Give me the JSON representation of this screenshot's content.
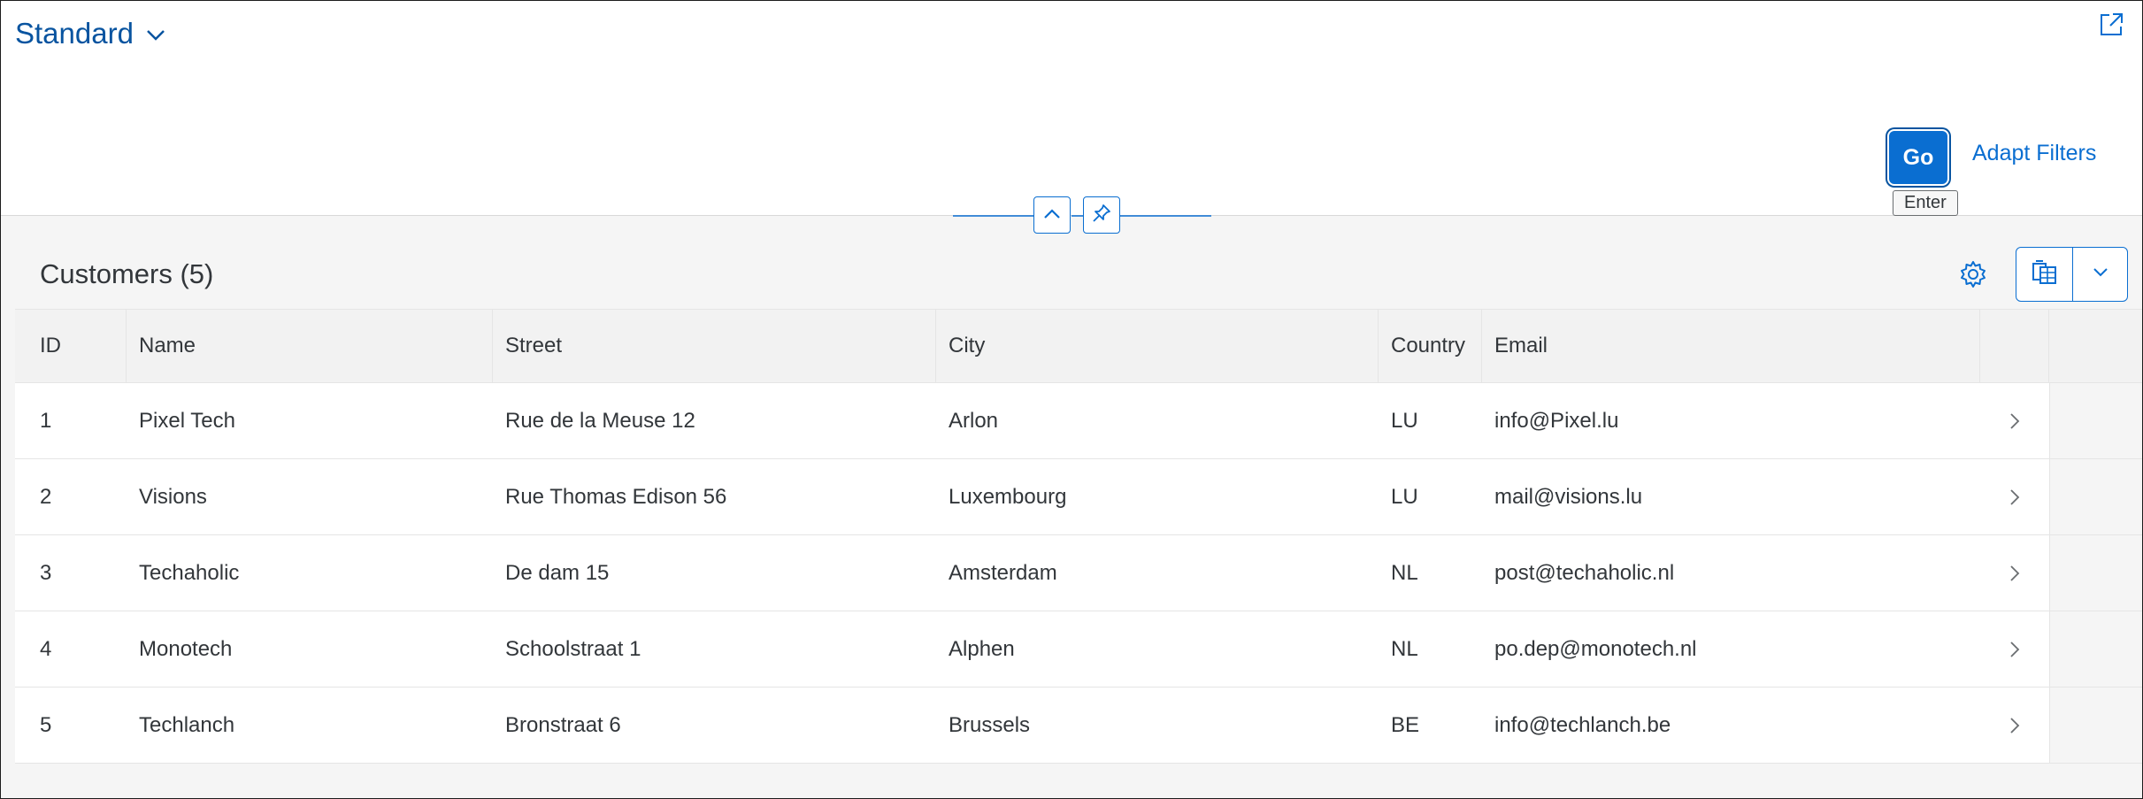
{
  "header": {
    "variant_title": "Standard",
    "go_label": "Go",
    "adapt_filters_label": "Adapt Filters",
    "go_tooltip": "Enter",
    "icons": {
      "variant_dropdown": "chevron-down-icon",
      "share": "share-icon",
      "collapse": "chevron-up-icon",
      "pin": "pin-icon"
    }
  },
  "table": {
    "title": "Customers (5)",
    "icons": {
      "settings": "gear-icon",
      "export": "spreadsheet-export-icon",
      "export_menu": "chevron-down-icon",
      "row_nav": "chevron-right-icon"
    },
    "columns": [
      "ID",
      "Name",
      "Street",
      "City",
      "Country",
      "Email"
    ],
    "rows": [
      {
        "id": "1",
        "name": "Pixel Tech",
        "street": "Rue de la Meuse 12",
        "city": "Arlon",
        "country": "LU",
        "email": "info@Pixel.lu"
      },
      {
        "id": "2",
        "name": "Visions",
        "street": "Rue Thomas Edison 56",
        "city": "Luxembourg",
        "country": "LU",
        "email": "mail@visions.lu"
      },
      {
        "id": "3",
        "name": "Techaholic",
        "street": "De dam 15",
        "city": "Amsterdam",
        "country": "NL",
        "email": "post@techaholic.nl"
      },
      {
        "id": "4",
        "name": "Monotech",
        "street": "Schoolstraat 1",
        "city": "Alphen",
        "country": "NL",
        "email": "po.dep@monotech.nl"
      },
      {
        "id": "5",
        "name": "Techlanch",
        "street": "Bronstraat 6",
        "city": "Brussels",
        "country": "BE",
        "email": "info@techlanch.be"
      }
    ]
  },
  "colors": {
    "accent": "#0a6ed1",
    "title_blue": "#0854a0",
    "text": "#32363a",
    "background": "#f5f5f5"
  }
}
